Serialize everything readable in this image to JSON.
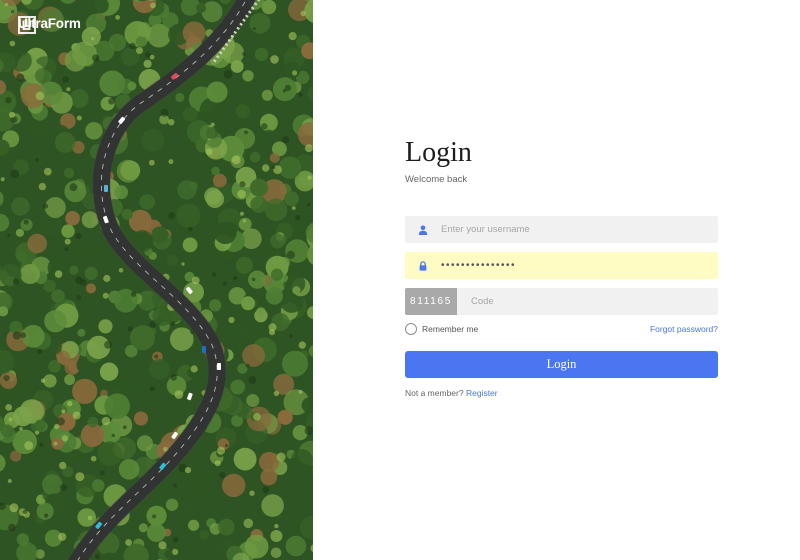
{
  "brand": {
    "name": "UltraForm",
    "logo_icon": "brand-logo-icon"
  },
  "login": {
    "title": "Login",
    "subtitle": "Welcome back",
    "username_placeholder": "Enter your username",
    "username_icon": "user-icon",
    "password_value": "•••••••••••••••",
    "password_icon": "lock-icon",
    "captcha_code": "811165",
    "code_placeholder": "Code",
    "remember_label": "Remember me",
    "forgot_label": "Forgot password?",
    "submit_label": "Login",
    "signup_prompt": "Not a member?",
    "signup_link": "Register"
  },
  "colors": {
    "accent": "#4a76f2",
    "field_bg": "#f1f1f1",
    "password_field_bg": "#fefcc3",
    "captcha_bg": "#a9a9a9",
    "hero_forest": "#2f5424"
  }
}
